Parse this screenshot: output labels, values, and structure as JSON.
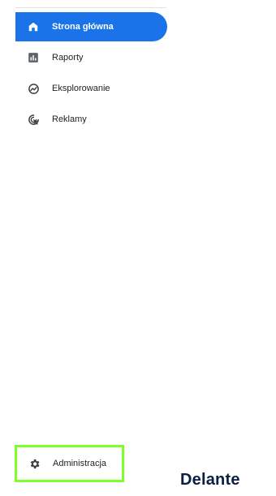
{
  "nav": {
    "items": [
      {
        "label": "Strona główna",
        "icon": "home-icon",
        "active": true
      },
      {
        "label": "Raporty",
        "icon": "reports-icon",
        "active": false
      },
      {
        "label": "Eksplorowanie",
        "icon": "explore-icon",
        "active": false
      },
      {
        "label": "Reklamy",
        "icon": "advertising-icon",
        "active": false
      }
    ]
  },
  "admin": {
    "label": "Administracja",
    "icon": "gear-icon"
  },
  "brand": {
    "logo_text": "Delante"
  },
  "colors": {
    "accent": "#1a73e8",
    "highlight_border": "#7dff2a",
    "brand_text": "#0b1f44"
  }
}
